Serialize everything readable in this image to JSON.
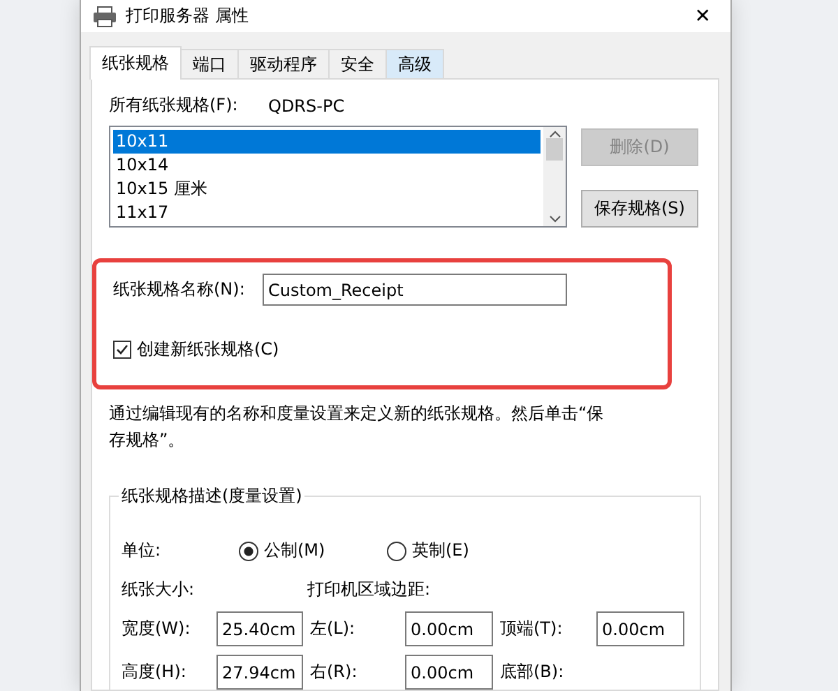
{
  "window": {
    "title": "打印服务器 属性",
    "close": "✕"
  },
  "tabs": [
    {
      "label": "纸张规格",
      "selected": true,
      "hover": false
    },
    {
      "label": "端口",
      "selected": false,
      "hover": false
    },
    {
      "label": "驱动程序",
      "selected": false,
      "hover": false
    },
    {
      "label": "安全",
      "selected": false,
      "hover": false
    },
    {
      "label": "高级",
      "selected": false,
      "hover": true
    }
  ],
  "forms_label": "所有纸张规格(F):",
  "server": "QDRS-PC",
  "forms": [
    {
      "label": "10x11",
      "selected": true
    },
    {
      "label": "10x14",
      "selected": false
    },
    {
      "label": "10x15 厘米",
      "selected": false
    },
    {
      "label": "11x17",
      "selected": false
    }
  ],
  "buttons": [
    {
      "label": "删除(D)",
      "disabled": true
    },
    {
      "label": "保存规格(S)",
      "disabled": false
    }
  ],
  "name_label": "纸张规格名称(N):",
  "name_value": "Custom_Receipt",
  "create_new": {
    "label": "创建新纸张规格(C)",
    "checked": true
  },
  "hint": "通过编辑现有的名称和度量设置来定义新的纸张规格。然后单击“保存规格”。",
  "group": {
    "title": "纸张规格描述(度量设置)",
    "units_label": "单位:",
    "units": [
      {
        "label": "公制(M)",
        "selected": true
      },
      {
        "label": "英制(E)",
        "selected": false
      }
    ],
    "size_label": "纸张大小:",
    "margins_label": "打印机区域边距:",
    "rows": [
      {
        "label": "宽度(W):",
        "value": "25.40cm",
        "m1_label": "左(L):",
        "m1_value": "0.00cm",
        "m2_label": "顶端(T):",
        "m2_value": "0.00cm"
      },
      {
        "label": "高度(H):",
        "value": "27.94cm",
        "m1_label": "右(R):",
        "m1_value": "0.00cm",
        "m2_label": "底部(B):"
      }
    ]
  }
}
